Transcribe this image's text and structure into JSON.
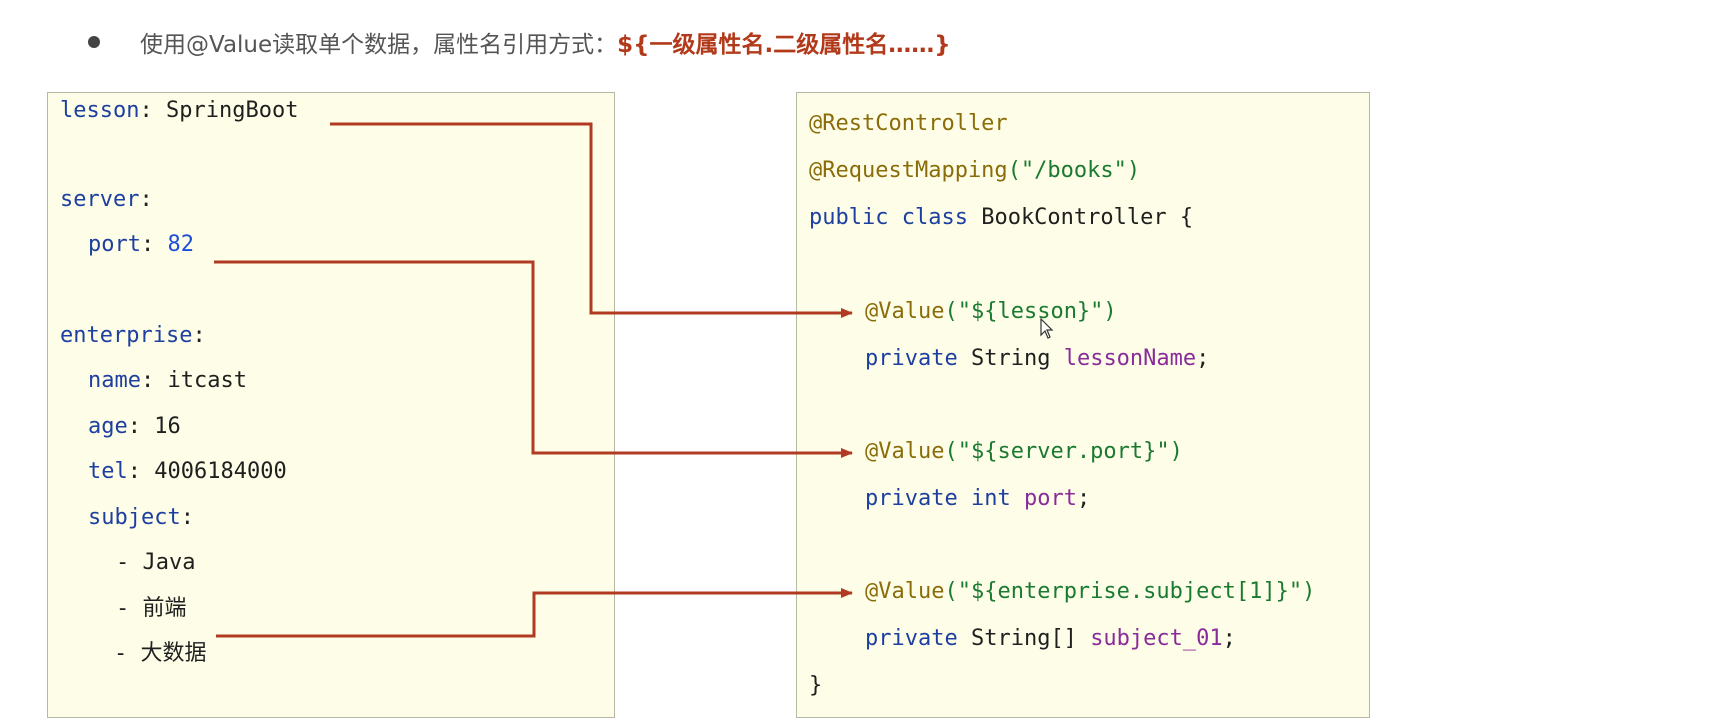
{
  "bullet": {
    "text": "使用@Value读取单个数据，属性名引用方式：",
    "emphasis": "${一级属性名.二级属性名……}"
  },
  "yaml": {
    "lesson_key": "lesson",
    "lesson_value": "SpringBoot",
    "server_key": "server",
    "port_key": "port",
    "port_value": "82",
    "enterprise_key": "enterprise",
    "name_key": "name",
    "name_value": "itcast",
    "age_key": "age",
    "age_value": "16",
    "tel_key": "tel",
    "tel_value": "4006184000",
    "subject_key": "subject",
    "subject_items": [
      "Java",
      "前端",
      "大数据"
    ]
  },
  "java": {
    "ann_rest": "@RestController",
    "ann_mapping": "@RequestMapping",
    "mapping_path": "(\"/books\")",
    "class_kw": "public class",
    "class_name": "BookController {",
    "value1_ann": "@Value",
    "value1_arg": "(\"${lesson}\")",
    "field1_kw": "private",
    "field1_type": "String",
    "field1_name": "lessonName",
    "value2_ann": "@Value",
    "value2_arg": "(\"${server.port}\")",
    "field2_kw": "private int",
    "field2_name": "port",
    "value3_ann": "@Value",
    "value3_arg": "(\"${enterprise.subject[1]}\")",
    "field3_kw": "private",
    "field3_type": "String[]",
    "field3_name": "subject_01",
    "closing": "}"
  },
  "colors": {
    "arrow": "#b13a22",
    "box_bg": "#fefde7",
    "emphasis": "#b23a1b"
  }
}
